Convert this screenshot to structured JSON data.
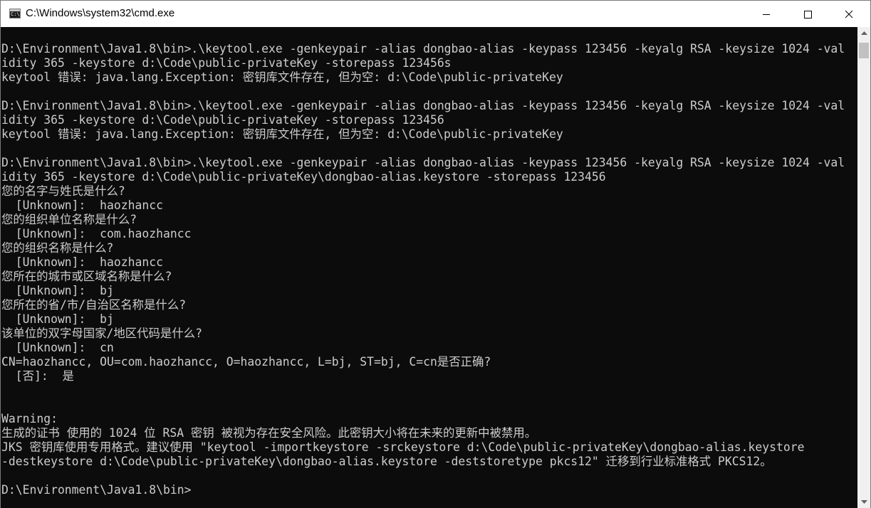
{
  "window": {
    "title": "C:\\Windows\\system32\\cmd.exe",
    "icon_text": "C:\\."
  },
  "console": {
    "lines": [
      "D:\\Environment\\Java1.8\\bin>.\\keytool.exe -genkeypair -alias dongbao-alias -keypass 123456 -keyalg RSA -keysize 1024 -val",
      "idity 365 -keystore d:\\Code\\public-privateKey -storepass 123456s",
      "keytool 错误: java.lang.Exception: 密钥库文件存在, 但为空: d:\\Code\\public-privateKey",
      "",
      "D:\\Environment\\Java1.8\\bin>.\\keytool.exe -genkeypair -alias dongbao-alias -keypass 123456 -keyalg RSA -keysize 1024 -val",
      "idity 365 -keystore d:\\Code\\public-privateKey -storepass 123456",
      "keytool 错误: java.lang.Exception: 密钥库文件存在, 但为空: d:\\Code\\public-privateKey",
      "",
      "D:\\Environment\\Java1.8\\bin>.\\keytool.exe -genkeypair -alias dongbao-alias -keypass 123456 -keyalg RSA -keysize 1024 -val",
      "idity 365 -keystore d:\\Code\\public-privateKey\\dongbao-alias.keystore -storepass 123456",
      "您的名字与姓氏是什么?",
      "  [Unknown]:  haozhancc",
      "您的组织单位名称是什么?",
      "  [Unknown]:  com.haozhancc",
      "您的组织名称是什么?",
      "  [Unknown]:  haozhancc",
      "您所在的城市或区域名称是什么?",
      "  [Unknown]:  bj",
      "您所在的省/市/自治区名称是什么?",
      "  [Unknown]:  bj",
      "该单位的双字母国家/地区代码是什么?",
      "  [Unknown]:  cn",
      "CN=haozhancc, OU=com.haozhancc, O=haozhancc, L=bj, ST=bj, C=cn是否正确?",
      "  [否]:  是",
      "",
      "",
      "Warning:",
      "生成的证书 使用的 1024 位 RSA 密钥 被视为存在安全风险。此密钥大小将在未来的更新中被禁用。",
      "JKS 密钥库使用专用格式。建议使用 \"keytool -importkeystore -srckeystore d:\\Code\\public-privateKey\\dongbao-alias.keystore",
      "-destkeystore d:\\Code\\public-privateKey\\dongbao-alias.keystore -deststoretype pkcs12\" 迁移到行业标准格式 PKCS12。",
      "",
      "D:\\Environment\\Java1.8\\bin>"
    ]
  },
  "colors": {
    "console_bg": "#0c0c0c",
    "console_fg": "#cccccc",
    "titlebar_bg": "#ffffff",
    "scrollbar_bg": "#f0f0f0",
    "scrollbar_thumb": "#c1c1c1"
  },
  "icons": [
    "console-app-icon",
    "minimize-icon",
    "maximize-icon",
    "close-icon",
    "scroll-up-arrow-icon",
    "scroll-down-arrow-icon"
  ]
}
